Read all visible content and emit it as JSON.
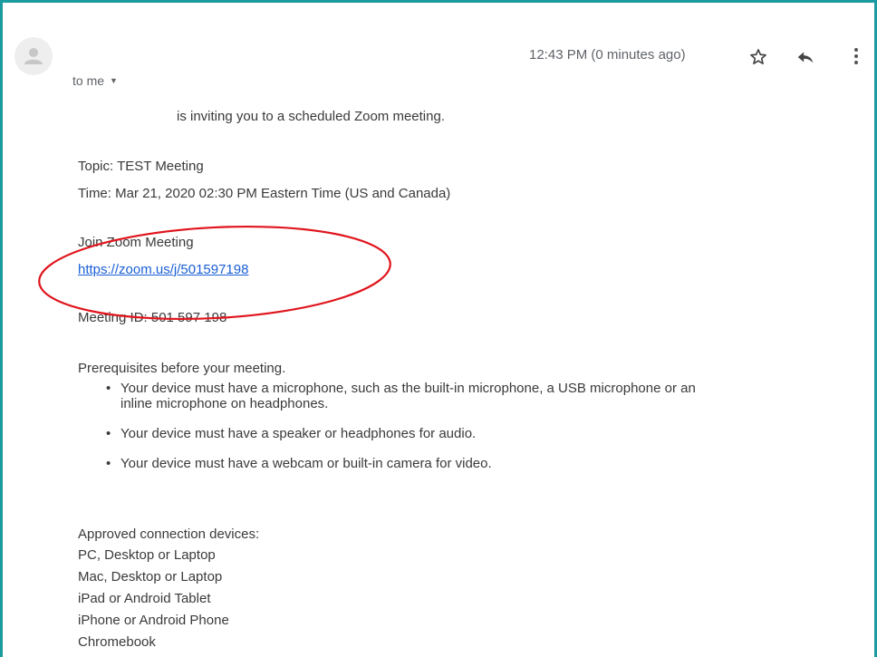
{
  "header": {
    "timestamp": "12:43 PM (0 minutes ago)",
    "recipient": "to me",
    "icons": {
      "avatar": "person-placeholder-icon",
      "star": "star-outline-icon",
      "reply": "reply-icon",
      "more": "more-vertical-icon",
      "recipient_dropdown": "caret-down-icon"
    }
  },
  "body": {
    "intro": "is inviting you to a scheduled Zoom meeting.",
    "topic": "Topic: TEST Meeting",
    "time": "Time: Mar 21, 2020 02:30 PM Eastern Time (US and Canada)",
    "join_label": "Join Zoom Meeting",
    "join_link": "https://zoom.us/j/501597198",
    "meeting_id": "Meeting ID: 501 597 198",
    "prereq_heading": "Prerequisites before your meeting.",
    "prereq_items": [
      {
        "line1": "Your device must have a microphone, such as the built-in microphone, a USB microphone or an",
        "line2": "inline microphone on headphones."
      },
      {
        "line1": "Your device must have a speaker or headphones for audio."
      },
      {
        "line1": "Your device must have a webcam or built-in camera for video."
      }
    ],
    "devices_heading": "Approved connection devices:",
    "devices": [
      "PC, Desktop or Laptop",
      "Mac, Desktop or Laptop",
      "iPad or Android Tablet",
      "iPhone or Android Phone",
      "Chromebook"
    ]
  },
  "colors": {
    "frame_border": "#1b9aa0",
    "link": "#1a5fd6",
    "annotation": "#e0141c"
  }
}
